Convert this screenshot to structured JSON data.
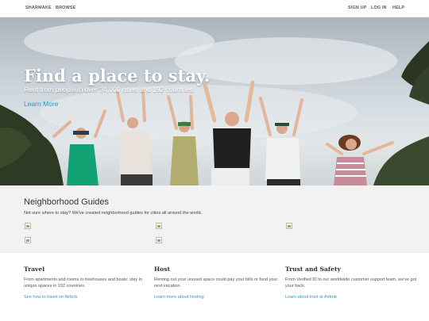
{
  "nav": {
    "brand": "SHARMAKE",
    "browse": "BROWSE",
    "signup": "SIGN UP",
    "login": "LOG IN",
    "help": "HELP"
  },
  "hero": {
    "title": "Find a place to stay.",
    "subtitle": "Rent from people in over 34,000 cities and 192 countries.",
    "cta": "Learn More"
  },
  "guides": {
    "title": "Neighborhood Guides",
    "description": "Not sure where to stay? We've created neighborhood guides for cities all around the world."
  },
  "columns": [
    {
      "title": "Travel",
      "text": "From apartments and rooms to treehouses and boats: stay in unique spaces in 192 countries.",
      "link": "See how to travel on Airbnb"
    },
    {
      "title": "Host",
      "text": "Renting out your unused space could pay your bills or fund your next vacation.",
      "link": "Learn more about hosting"
    },
    {
      "title": "Trust and Safety",
      "text": "From Verified ID to our worldwide customer support team, we've got your back.",
      "link": "Learn about trust at Airbnb"
    }
  ],
  "colors": {
    "link": "#2a9ad8",
    "guides_bg": "#f2f2f2"
  }
}
